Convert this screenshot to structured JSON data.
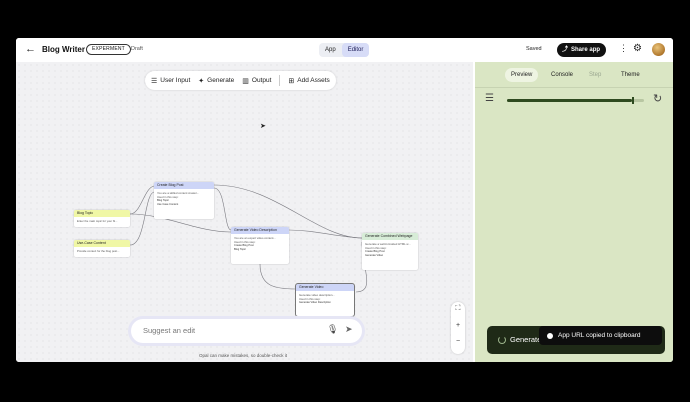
{
  "header": {
    "back_icon": "arrow-left-icon",
    "title": "Blog Writer",
    "badge": "EXPERMENT",
    "status": "Draft",
    "mode_tabs": [
      "App",
      "Editor"
    ],
    "active_mode": "Editor",
    "saved": "Saved",
    "share_label": "Share app"
  },
  "toolbar": {
    "items": [
      {
        "label": "User Input",
        "icon": "list-icon"
      },
      {
        "label": "Generate",
        "icon": "sparkle-icon"
      },
      {
        "label": "Output",
        "icon": "bar-chart-icon"
      },
      {
        "label": "Add Assets",
        "icon": "add-asset-icon"
      }
    ]
  },
  "nodes": {
    "create_blog_post": {
      "title": "Create Blog Post",
      "body": "You are a skilled content creator...",
      "sub": "Used in this step:",
      "chips": [
        "Blog Topic",
        "Use Case Content"
      ]
    },
    "blog_topic": {
      "title": "Blog Topic",
      "body": "Enter the main topic for your bl..."
    },
    "use_case": {
      "title": "Use-Case Content",
      "body": "Provide context for the blog post..."
    },
    "video_desc": {
      "title": "Generate Video Description",
      "body": "You are an expert video content...",
      "sub": "Used in this step:",
      "chips": [
        "Create Blog Post",
        "Blog Topic"
      ]
    },
    "webpage": {
      "title": "Generate Combined Webpage",
      "body": "Generate a well-formatted HTML w...",
      "sub": "Used in this step:",
      "chips": [
        "Create Blog Post",
        "Generate Video"
      ]
    },
    "gen_video": {
      "title": "Generate Video",
      "body": "Generate video description...",
      "sub": "Used in this step:",
      "chips": [
        "Generate Video Description"
      ]
    }
  },
  "prompt": {
    "placeholder": "Suggest an edit",
    "disclaimer": "Opal can make mistakes, so double-check it"
  },
  "zoom": {
    "fit": "fit-icon",
    "in": "+",
    "out": "−"
  },
  "panel": {
    "tabs": [
      "Preview",
      "Console",
      "Step",
      "Theme"
    ],
    "active_tab": "Preview",
    "progress": 0.91,
    "generate_label": "Generate",
    "toast": "App URL copied to clipboard"
  },
  "colors": {
    "panel_bg": "#dae6c4",
    "accent_dark": "#1f2a17",
    "mode_active": "#d7dcf7"
  }
}
